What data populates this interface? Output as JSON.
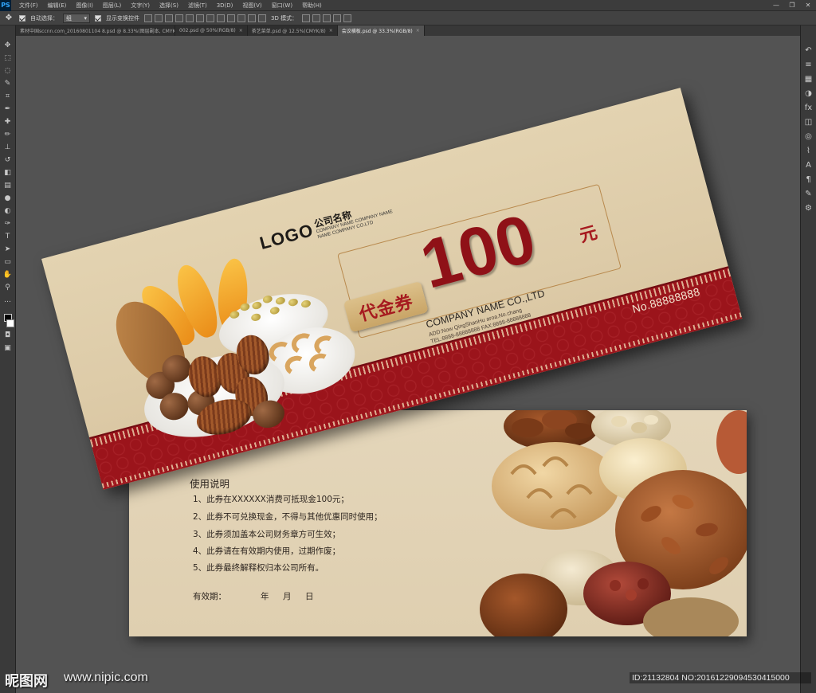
{
  "app": {
    "name": "Photoshop",
    "logo_text": "PS",
    "menu": [
      "文件(F)",
      "编辑(E)",
      "图像(I)",
      "图层(L)",
      "文字(Y)",
      "选择(S)",
      "滤镜(T)",
      "3D(D)",
      "视图(V)",
      "窗口(W)",
      "帮助(H)"
    ],
    "window_controls": [
      "—",
      "❐",
      "✕"
    ]
  },
  "options": {
    "auto_select_label": "自动选择：",
    "auto_select_value": "组",
    "show_transform_label": "显示变换控件",
    "mode_3d_label": "3D 模式："
  },
  "tabs": [
    {
      "label": "素材中国sccnn.com_20160801104 8.psd @ 8.33%(图层副本, CMYK/8#)"
    },
    {
      "label": "002.psd @ 50%(RGB/8)"
    },
    {
      "label": "茶艺菜单.psd @ 12.5%(CMYK/8)"
    },
    {
      "label": "会议横板.psd @ 33.3%(RGB/8)"
    }
  ],
  "voucher_front": {
    "logo": "LOGO",
    "company_cn": "公司名称",
    "company_en_1": "COMPANY NAME COMPANY NAME",
    "company_en_2": "NAME COMPANY CO.LTD",
    "badge": "代金券",
    "amount": "100",
    "currency": "元",
    "company_name_en": "COMPANY NAME CO.,LTD",
    "address": "ADD:Now QingShanHu aroa.No.chang",
    "phone": "TEL:8888-88888888  FAX:8888-88888888",
    "serial": "No.88888888",
    "colors": {
      "paper": "#e3d3b1",
      "band": "#9b141b",
      "accent": "#8f1117"
    }
  },
  "voucher_back": {
    "title": "使用说明",
    "rules": [
      "1、此券在XXXXXX消费可抵现金100元；",
      "2、此券不可兑换现金，不得与其他优惠同时使用；",
      "3、此券须加盖本公司财务章方可生效；",
      "4、此券请在有效期内使用，过期作废；",
      "5、此券最终解释权归本公司所有。"
    ],
    "valid_label": "有效期：",
    "year": "年",
    "month": "月",
    "day": "日"
  },
  "watermark": {
    "site_logo": "昵图网",
    "url": "www.nipic.com",
    "id": "ID:21132804 NO:20161229094530415000"
  }
}
